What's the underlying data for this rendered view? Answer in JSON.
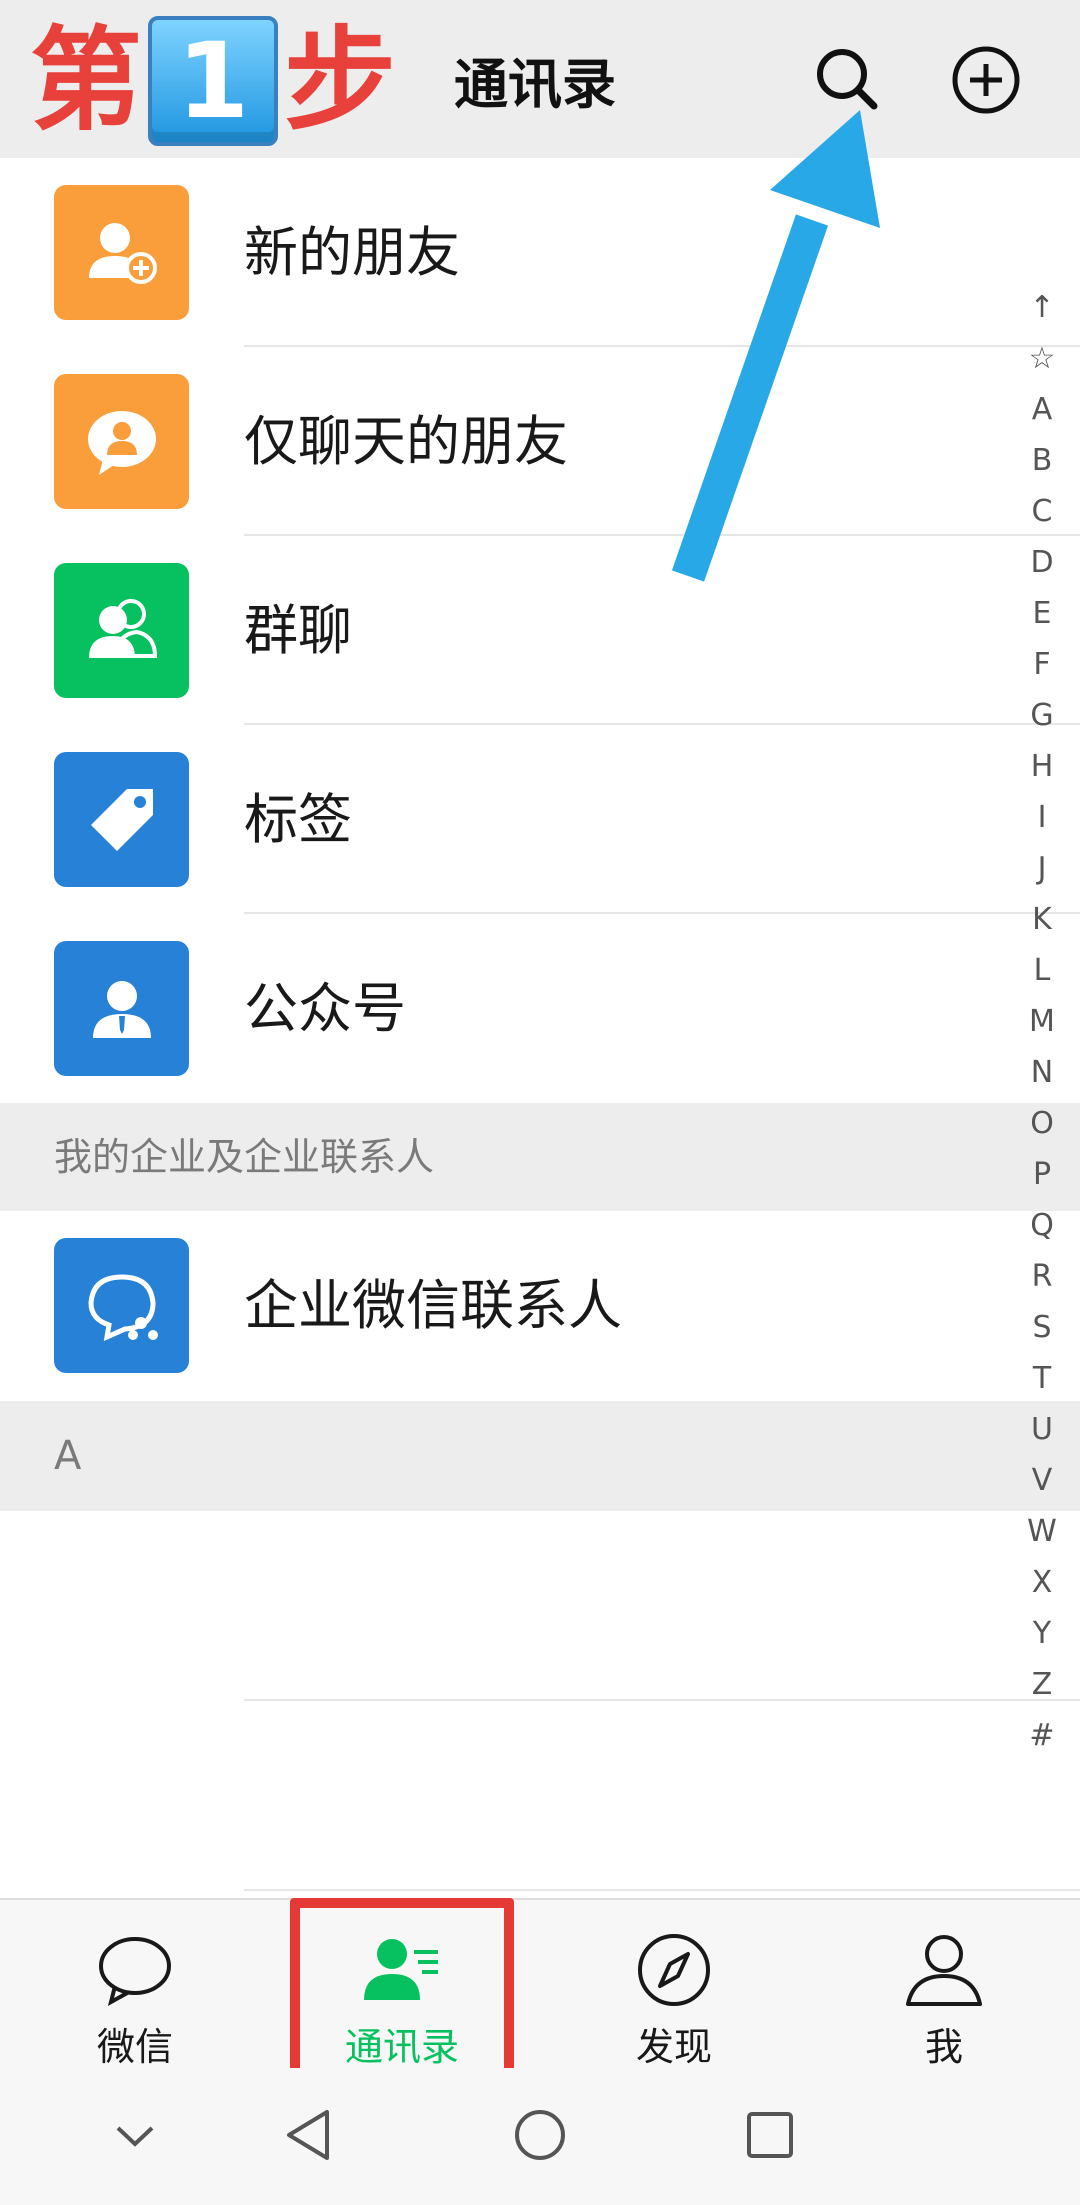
{
  "annotation": {
    "step_prefix": "第",
    "step_number": "1",
    "step_suffix": "步"
  },
  "header": {
    "title": "通讯录",
    "search_icon": "search-icon",
    "add_icon": "plus-circle-icon"
  },
  "menu": [
    {
      "label": "新的朋友",
      "icon": "add-friend-icon",
      "color": "#fa9d3b"
    },
    {
      "label": "仅聊天的朋友",
      "icon": "chat-only-friend-icon",
      "color": "#fa9d3b"
    },
    {
      "label": "群聊",
      "icon": "group-chat-icon",
      "color": "#07c160"
    },
    {
      "label": "标签",
      "icon": "tag-icon",
      "color": "#2782d7"
    },
    {
      "label": "公众号",
      "icon": "official-account-icon",
      "color": "#2782d7"
    }
  ],
  "section_enterprise": "我的企业及企业联系人",
  "enterprise_item": {
    "label": "企业微信联系人",
    "icon": "wecom-icon",
    "color": "#2782d7"
  },
  "section_a": "A",
  "index": [
    "↑",
    "☆",
    "A",
    "B",
    "C",
    "D",
    "E",
    "F",
    "G",
    "H",
    "I",
    "J",
    "K",
    "L",
    "M",
    "N",
    "O",
    "P",
    "Q",
    "R",
    "S",
    "T",
    "U",
    "V",
    "W",
    "X",
    "Y",
    "Z",
    "#"
  ],
  "tabs": [
    {
      "label": "微信",
      "icon": "chat-bubble-icon"
    },
    {
      "label": "通讯录",
      "icon": "contacts-icon",
      "active": true
    },
    {
      "label": "发现",
      "icon": "compass-icon"
    },
    {
      "label": "我",
      "icon": "person-icon"
    }
  ],
  "colors": {
    "accent": "#07c160",
    "highlight": "#e53935",
    "arrow": "#29a8e8"
  },
  "system_nav": [
    "chevron-down-icon",
    "back-triangle-icon",
    "home-circle-icon",
    "recents-square-icon"
  ]
}
